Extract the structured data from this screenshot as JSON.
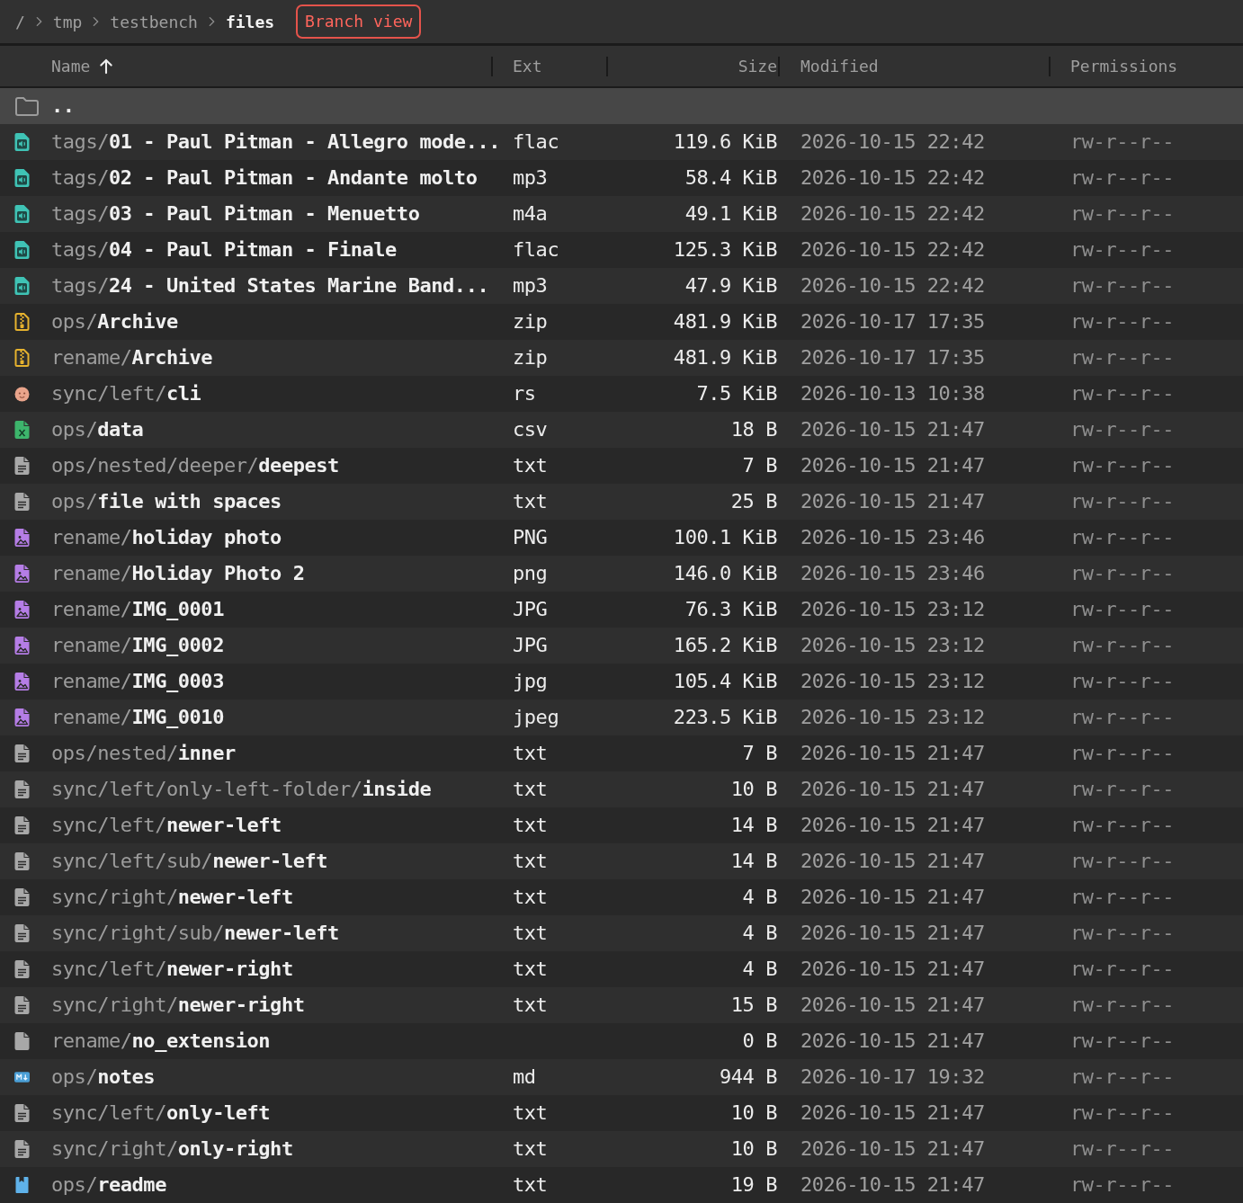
{
  "breadcrumb": [
    {
      "label": "/",
      "current": false
    },
    {
      "label": "tmp",
      "current": false
    },
    {
      "label": "testbench",
      "current": false
    },
    {
      "label": "files",
      "current": true
    }
  ],
  "mode_badge": "Branch view",
  "columns": [
    {
      "label": "Name",
      "sorted": true
    },
    {
      "label": "Ext",
      "sorted": false
    },
    {
      "label": "Size",
      "sorted": false
    },
    {
      "label": "Modified",
      "sorted": false
    },
    {
      "label": "Permissions",
      "sorted": false
    }
  ],
  "parent": {
    "label": "..",
    "selected": true
  },
  "rows": [
    {
      "kind": "audio",
      "path": "tags/",
      "name": "01 - Paul Pitman - Allegro mode...",
      "ext": "flac",
      "size": "119.6 KiB",
      "modified": "2026-10-15 22:42",
      "permissions": "rw-r--r--",
      "selected": false
    },
    {
      "kind": "audio",
      "path": "tags/",
      "name": "02 - Paul Pitman - Andante molto",
      "ext": "mp3",
      "size": "58.4 KiB",
      "modified": "2026-10-15 22:42",
      "permissions": "rw-r--r--",
      "selected": false
    },
    {
      "kind": "audio",
      "path": "tags/",
      "name": "03 - Paul Pitman - Menuetto",
      "ext": "m4a",
      "size": "49.1 KiB",
      "modified": "2026-10-15 22:42",
      "permissions": "rw-r--r--",
      "selected": false
    },
    {
      "kind": "audio",
      "path": "tags/",
      "name": "04 - Paul Pitman - Finale",
      "ext": "flac",
      "size": "125.3 KiB",
      "modified": "2026-10-15 22:42",
      "permissions": "rw-r--r--",
      "selected": false
    },
    {
      "kind": "audio",
      "path": "tags/",
      "name": "24 - United States Marine Band...",
      "ext": "mp3",
      "size": "47.9 KiB",
      "modified": "2026-10-15 22:42",
      "permissions": "rw-r--r--",
      "selected": false
    },
    {
      "kind": "archive",
      "path": "ops/",
      "name": "Archive",
      "ext": "zip",
      "size": "481.9 KiB",
      "modified": "2026-10-17 17:35",
      "permissions": "rw-r--r--",
      "selected": false
    },
    {
      "kind": "archive",
      "path": "rename/",
      "name": "Archive",
      "ext": "zip",
      "size": "481.9 KiB",
      "modified": "2026-10-17 17:35",
      "permissions": "rw-r--r--",
      "selected": false
    },
    {
      "kind": "face",
      "path": "sync/left/",
      "name": "cli",
      "ext": "rs",
      "size": "7.5 KiB",
      "modified": "2026-10-13 10:38",
      "permissions": "rw-r--r--",
      "selected": false
    },
    {
      "kind": "sheet",
      "path": "ops/",
      "name": "data",
      "ext": "csv",
      "size": "18 B",
      "modified": "2026-10-15 21:47",
      "permissions": "rw-r--r--",
      "selected": false
    },
    {
      "kind": "text",
      "path": "ops/nested/deeper/",
      "name": "deepest",
      "ext": "txt",
      "size": "7 B",
      "modified": "2026-10-15 21:47",
      "permissions": "rw-r--r--",
      "selected": false
    },
    {
      "kind": "text",
      "path": "ops/",
      "name": "file with spaces",
      "ext": "txt",
      "size": "25 B",
      "modified": "2026-10-15 21:47",
      "permissions": "rw-r--r--",
      "selected": false
    },
    {
      "kind": "image",
      "path": "rename/",
      "name": "holiday photo",
      "ext": "PNG",
      "size": "100.1 KiB",
      "modified": "2026-10-15 23:46",
      "permissions": "rw-r--r--",
      "selected": false
    },
    {
      "kind": "image",
      "path": "rename/",
      "name": "Holiday Photo 2",
      "ext": "png",
      "size": "146.0 KiB",
      "modified": "2026-10-15 23:46",
      "permissions": "rw-r--r--",
      "selected": false
    },
    {
      "kind": "image",
      "path": "rename/",
      "name": "IMG_0001",
      "ext": "JPG",
      "size": "76.3 KiB",
      "modified": "2026-10-15 23:12",
      "permissions": "rw-r--r--",
      "selected": false
    },
    {
      "kind": "image",
      "path": "rename/",
      "name": "IMG_0002",
      "ext": "JPG",
      "size": "165.2 KiB",
      "modified": "2026-10-15 23:12",
      "permissions": "rw-r--r--",
      "selected": false
    },
    {
      "kind": "image",
      "path": "rename/",
      "name": "IMG_0003",
      "ext": "jpg",
      "size": "105.4 KiB",
      "modified": "2026-10-15 23:12",
      "permissions": "rw-r--r--",
      "selected": false
    },
    {
      "kind": "image",
      "path": "rename/",
      "name": "IMG_0010",
      "ext": "jpeg",
      "size": "223.5 KiB",
      "modified": "2026-10-15 23:12",
      "permissions": "rw-r--r--",
      "selected": false
    },
    {
      "kind": "text",
      "path": "ops/nested/",
      "name": "inner",
      "ext": "txt",
      "size": "7 B",
      "modified": "2026-10-15 21:47",
      "permissions": "rw-r--r--",
      "selected": false
    },
    {
      "kind": "text",
      "path": "sync/left/only-left-folder/",
      "name": "inside",
      "ext": "txt",
      "size": "10 B",
      "modified": "2026-10-15 21:47",
      "permissions": "rw-r--r--",
      "selected": false
    },
    {
      "kind": "text",
      "path": "sync/left/",
      "name": "newer-left",
      "ext": "txt",
      "size": "14 B",
      "modified": "2026-10-15 21:47",
      "permissions": "rw-r--r--",
      "selected": false
    },
    {
      "kind": "text",
      "path": "sync/left/sub/",
      "name": "newer-left",
      "ext": "txt",
      "size": "14 B",
      "modified": "2026-10-15 21:47",
      "permissions": "rw-r--r--",
      "selected": false
    },
    {
      "kind": "text",
      "path": "sync/right/",
      "name": "newer-left",
      "ext": "txt",
      "size": "4 B",
      "modified": "2026-10-15 21:47",
      "permissions": "rw-r--r--",
      "selected": false
    },
    {
      "kind": "text",
      "path": "sync/right/sub/",
      "name": "newer-left",
      "ext": "txt",
      "size": "4 B",
      "modified": "2026-10-15 21:47",
      "permissions": "rw-r--r--",
      "selected": false
    },
    {
      "kind": "text",
      "path": "sync/left/",
      "name": "newer-right",
      "ext": "txt",
      "size": "4 B",
      "modified": "2026-10-15 21:47",
      "permissions": "rw-r--r--",
      "selected": false
    },
    {
      "kind": "text",
      "path": "sync/right/",
      "name": "newer-right",
      "ext": "txt",
      "size": "15 B",
      "modified": "2026-10-15 21:47",
      "permissions": "rw-r--r--",
      "selected": false
    },
    {
      "kind": "blank",
      "path": "rename/",
      "name": "no_extension",
      "size": "0 B",
      "modified": "2026-10-15 21:47",
      "permissions": "rw-r--r--",
      "selected": false
    },
    {
      "kind": "markdown",
      "path": "ops/",
      "name": "notes",
      "ext": "md",
      "size": "944 B",
      "modified": "2026-10-17 19:32",
      "permissions": "rw-r--r--",
      "selected": false
    },
    {
      "kind": "text",
      "path": "sync/left/",
      "name": "only-left",
      "ext": "txt",
      "size": "10 B",
      "modified": "2026-10-15 21:47",
      "permissions": "rw-r--r--",
      "selected": false
    },
    {
      "kind": "text",
      "path": "sync/right/",
      "name": "only-right",
      "ext": "txt",
      "size": "10 B",
      "modified": "2026-10-15 21:47",
      "permissions": "rw-r--r--",
      "selected": false
    },
    {
      "kind": "book",
      "path": "ops/",
      "name": "readme",
      "ext": "txt",
      "size": "19 B",
      "modified": "2026-10-15 21:47",
      "permissions": "rw-r--r--",
      "selected": false
    }
  ]
}
